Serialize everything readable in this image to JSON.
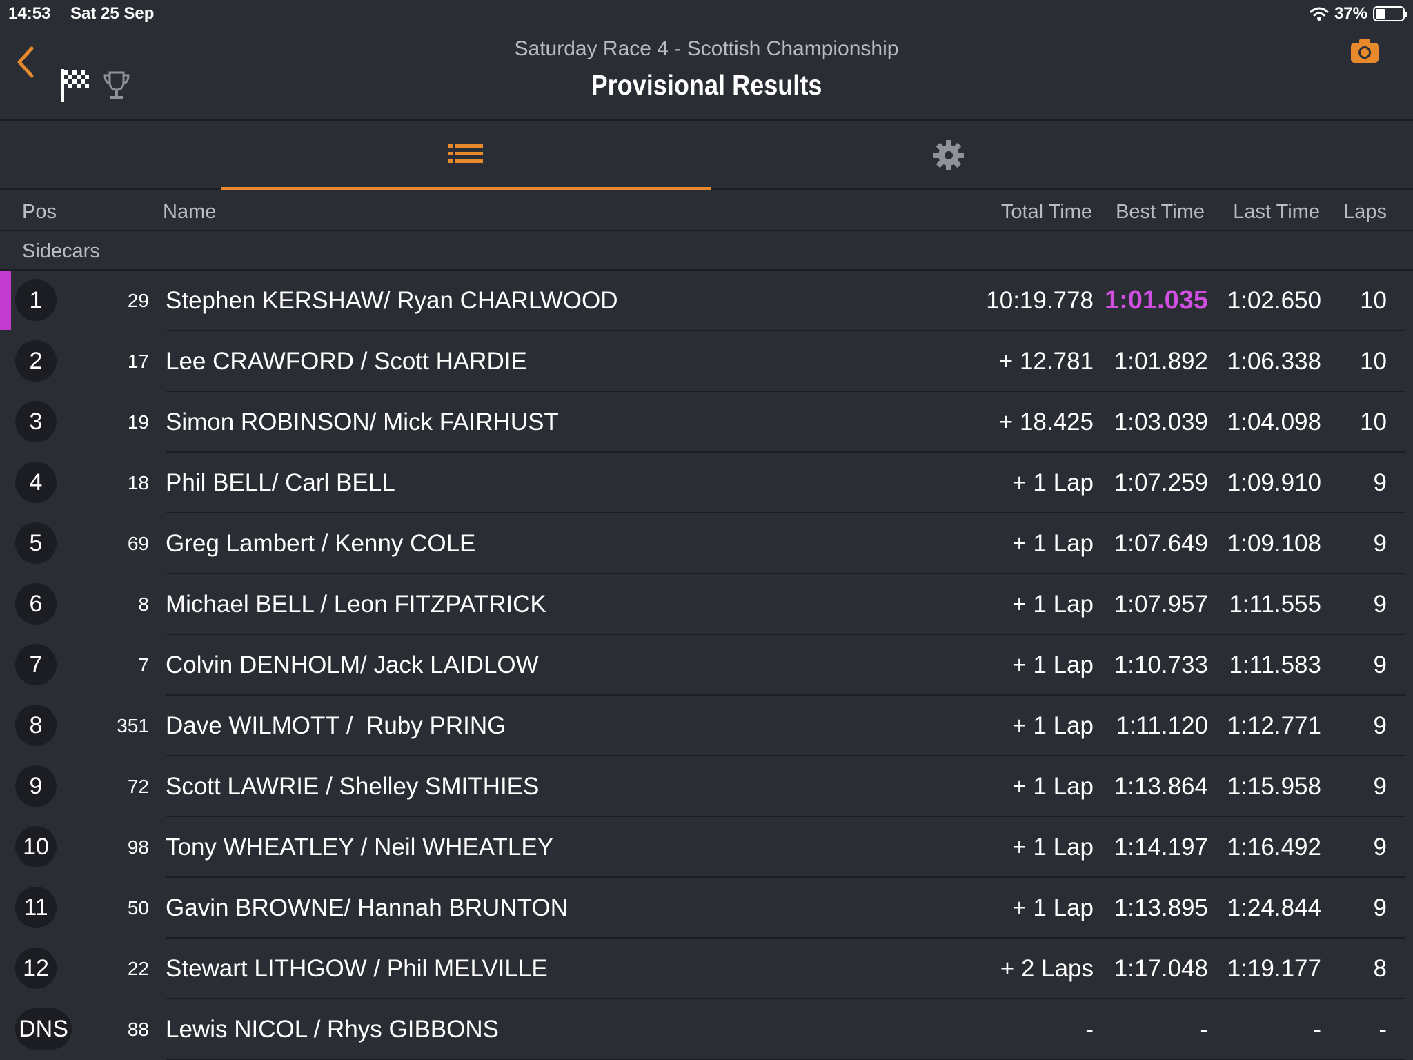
{
  "status_bar": {
    "time": "14:53",
    "date": "Sat 25 Sep",
    "battery": "37%",
    "battery_level": 0.37
  },
  "header": {
    "subtitle": "Saturday Race 4 - Scottish Championship",
    "title": "Provisional Results"
  },
  "icons": {
    "back": "chevron-left-icon",
    "flag": "checkered-flag-icon",
    "trophy": "trophy-icon",
    "camera": "camera-icon",
    "list": "list-icon",
    "settings": "gear-icon",
    "wifi": "wifi-icon",
    "battery": "battery-icon"
  },
  "colors": {
    "accent": "#e8892e",
    "fastest_lap": "#d04fe0",
    "background": "#2a2d34"
  },
  "columns": {
    "pos": "Pos",
    "name": "Name",
    "total": "Total Time",
    "best": "Best Time",
    "last": "Last Time",
    "laps": "Laps"
  },
  "class_label": "Sidecars",
  "results": [
    {
      "pos": "1",
      "num": "29",
      "name": "Stephen KERSHAW/ Ryan CHARLWOOD",
      "total": "10:19.778",
      "best": "1:01.035",
      "last": "1:02.650",
      "laps": "10"
    },
    {
      "pos": "2",
      "num": "17",
      "name": "Lee CRAWFORD / Scott HARDIE",
      "total": "+ 12.781",
      "best": "1:01.892",
      "last": "1:06.338",
      "laps": "10"
    },
    {
      "pos": "3",
      "num": "19",
      "name": "Simon ROBINSON/ Mick FAIRHUST",
      "total": "+ 18.425",
      "best": "1:03.039",
      "last": "1:04.098",
      "laps": "10"
    },
    {
      "pos": "4",
      "num": "18",
      "name": "Phil BELL/ Carl BELL",
      "total": "+ 1 Lap",
      "best": "1:07.259",
      "last": "1:09.910",
      "laps": "9"
    },
    {
      "pos": "5",
      "num": "69",
      "name": "Greg Lambert / Kenny COLE",
      "total": "+ 1 Lap",
      "best": "1:07.649",
      "last": "1:09.108",
      "laps": "9"
    },
    {
      "pos": "6",
      "num": "8",
      "name": "Michael BELL / Leon FITZPATRICK",
      "total": "+ 1 Lap",
      "best": "1:07.957",
      "last": "1:11.555",
      "laps": "9"
    },
    {
      "pos": "7",
      "num": "7",
      "name": "Colvin DENHOLM/ Jack LAIDLOW",
      "total": "+ 1 Lap",
      "best": "1:10.733",
      "last": "1:11.583",
      "laps": "9"
    },
    {
      "pos": "8",
      "num": "351",
      "name": "Dave WILMOTT /  Ruby PRING",
      "total": "+ 1 Lap",
      "best": "1:11.120",
      "last": "1:12.771",
      "laps": "9"
    },
    {
      "pos": "9",
      "num": "72",
      "name": "Scott LAWRIE / Shelley SMITHIES",
      "total": "+ 1 Lap",
      "best": "1:13.864",
      "last": "1:15.958",
      "laps": "9"
    },
    {
      "pos": "10",
      "num": "98",
      "name": "Tony WHEATLEY / Neil WHEATLEY",
      "total": "+ 1 Lap",
      "best": "1:14.197",
      "last": "1:16.492",
      "laps": "9"
    },
    {
      "pos": "11",
      "num": "50",
      "name": "Gavin BROWNE/ Hannah BRUNTON",
      "total": "+ 1 Lap",
      "best": "1:13.895",
      "last": "1:24.844",
      "laps": "9"
    },
    {
      "pos": "12",
      "num": "22",
      "name": "Stewart LITHGOW / Phil MELVILLE",
      "total": "+ 2 Laps",
      "best": "1:17.048",
      "last": "1:19.177",
      "laps": "8"
    },
    {
      "pos": "DNS",
      "num": "88",
      "name": "Lewis NICOL / Rhys GIBBONS",
      "total": "-",
      "best": "-",
      "last": "-",
      "laps": "-"
    }
  ]
}
